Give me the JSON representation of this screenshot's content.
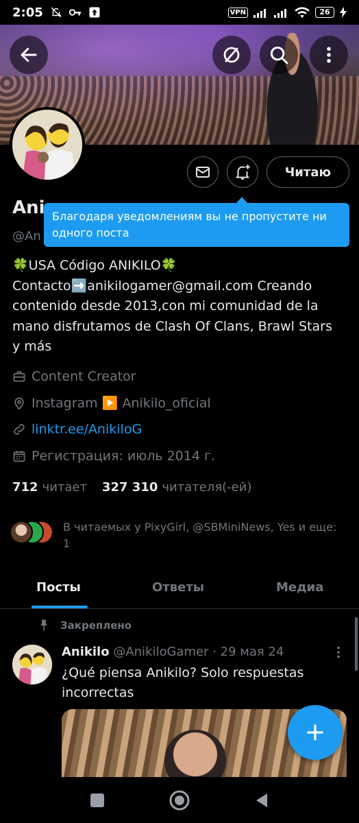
{
  "status_bar": {
    "time": "2:05",
    "vpn": "VPN",
    "battery": "26"
  },
  "profile": {
    "name": "Ani",
    "handle": "@An",
    "follow_button": "Читаю",
    "bio": "🍀USA Código ANIKILO🍀\nContacto➡️anikilogamer@gmail.com Creando contenido desde 2013,con mi comunidad de la mano disfrutamos de Clash Of Clans, Brawl Stars y más",
    "category": "Content Creator",
    "location": "Instagram ▶️ Anikilo_oficial",
    "website": "linktr.ee/AnikiloG",
    "joined": "Регистрация: июль 2014 г.",
    "following_count": "712",
    "following_label": "читает",
    "followers_count": "327 310",
    "followers_label": "читателя(-ей)",
    "followed_by": "В читаемых у PixyGirl, @SBMiniNews, Yes и еще: 1"
  },
  "tooltip": {
    "text": "Благодаря уведомлениям вы не пропустите ни одного поста"
  },
  "tabs": [
    {
      "label": "Посты",
      "active": true
    },
    {
      "label": "Ответы",
      "active": false
    },
    {
      "label": "Медиа",
      "active": false
    }
  ],
  "pinned_tweet": {
    "pinned_label": "Закреплено",
    "author": "Anikilo",
    "handle_date": "@AnikiloGamer · 29 мая 24",
    "text": "¿Qué piensa Anikilo? Solo respuestas incorrectas"
  },
  "icons": {
    "back": "arrow-left-icon",
    "hide": "eye-off-icon",
    "search": "search-icon",
    "more": "more-vertical-icon",
    "message": "envelope-icon",
    "notify": "bell-plus-icon",
    "compose": "plus-icon"
  },
  "colors": {
    "accent": "#1d9bf0",
    "background": "#000000",
    "muted": "#71767b"
  }
}
